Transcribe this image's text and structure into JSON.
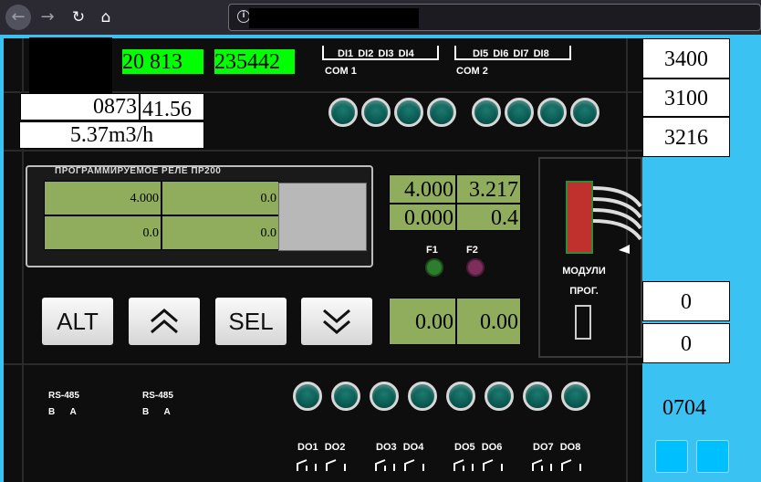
{
  "browser": {
    "back_icon": "←",
    "forward_icon": "→",
    "reload_icon": "↻",
    "home_icon": "⌂",
    "info_icon": "i"
  },
  "display": {
    "top_green_1": "20  813",
    "top_green_2": "235442",
    "counter": "0873",
    "value_top": "41.56",
    "flow": "5.37m3/h"
  },
  "inputs": {
    "group1": [
      "DI1",
      "DI2",
      "DI3",
      "DI4"
    ],
    "group1_label": "COM 1",
    "group2": [
      "DI5",
      "DI6",
      "DI7",
      "DI8"
    ],
    "group2_label": "COM 2"
  },
  "screen": {
    "title": "ПРОГРАММИРУЕМОЕ РЕЛЕ  ПР200",
    "cells": [
      "4.000",
      "0.0",
      "0.0",
      "0.0"
    ]
  },
  "right_grid": {
    "top": [
      "4.000",
      "3.217",
      "0.000",
      "0.4"
    ],
    "bottom": [
      "0.00",
      "0.00"
    ]
  },
  "indicators": {
    "f1": "F1",
    "f2": "F2",
    "f1_color": "#2e7d2e",
    "f2_color": "#7d2e5a"
  },
  "keys": {
    "alt": "ALT",
    "up_icon": "double-chevron-up",
    "sel": "SEL",
    "down_icon": "double-chevron-down"
  },
  "module": {
    "label_1": "МОДУЛИ",
    "label_2": "ПРОГ."
  },
  "rs485": {
    "label": "RS-485",
    "b": "B",
    "a": "A"
  },
  "outputs": [
    "DO1",
    "DO2",
    "DO3",
    "DO4",
    "DO5",
    "DO6",
    "DO7",
    "DO8"
  ],
  "sidebar": {
    "values_top": [
      "3400",
      "3100",
      "3216"
    ],
    "values_mid": [
      "0",
      "0"
    ],
    "code": "0704"
  },
  "colors": {
    "accent": "#3ac3f2",
    "lcd_green": "#8fad5d",
    "highlight_green": "#00ff00"
  }
}
